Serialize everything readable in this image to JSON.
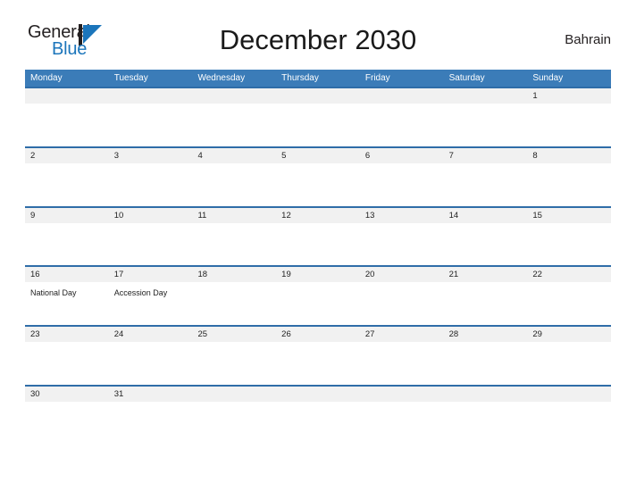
{
  "brand": {
    "word_one": "General",
    "word_two": "Blue",
    "mark_icon": "sailboat-flag-icon",
    "dark_color": "#231f20",
    "blue_color": "#1b75bb"
  },
  "header": {
    "title": "December 2030",
    "country": "Bahrain"
  },
  "colors": {
    "header_blue": "#3b7cb8",
    "row_divider_blue": "#2f6da8",
    "daynum_band_gray": "#f1f1f1",
    "page_background": "#ffffff",
    "text": "#222222"
  },
  "calendar": {
    "weekday_headers": [
      "Monday",
      "Tuesday",
      "Wednesday",
      "Thursday",
      "Friday",
      "Saturday",
      "Sunday"
    ],
    "weeks": [
      {
        "days": [
          {
            "number": "",
            "event": ""
          },
          {
            "number": "",
            "event": ""
          },
          {
            "number": "",
            "event": ""
          },
          {
            "number": "",
            "event": ""
          },
          {
            "number": "",
            "event": ""
          },
          {
            "number": "",
            "event": ""
          },
          {
            "number": "1",
            "event": ""
          }
        ]
      },
      {
        "days": [
          {
            "number": "2",
            "event": ""
          },
          {
            "number": "3",
            "event": ""
          },
          {
            "number": "4",
            "event": ""
          },
          {
            "number": "5",
            "event": ""
          },
          {
            "number": "6",
            "event": ""
          },
          {
            "number": "7",
            "event": ""
          },
          {
            "number": "8",
            "event": ""
          }
        ]
      },
      {
        "days": [
          {
            "number": "9",
            "event": ""
          },
          {
            "number": "10",
            "event": ""
          },
          {
            "number": "11",
            "event": ""
          },
          {
            "number": "12",
            "event": ""
          },
          {
            "number": "13",
            "event": ""
          },
          {
            "number": "14",
            "event": ""
          },
          {
            "number": "15",
            "event": ""
          }
        ]
      },
      {
        "days": [
          {
            "number": "16",
            "event": "National Day"
          },
          {
            "number": "17",
            "event": "Accession Day"
          },
          {
            "number": "18",
            "event": ""
          },
          {
            "number": "19",
            "event": ""
          },
          {
            "number": "20",
            "event": ""
          },
          {
            "number": "21",
            "event": ""
          },
          {
            "number": "22",
            "event": ""
          }
        ]
      },
      {
        "days": [
          {
            "number": "23",
            "event": ""
          },
          {
            "number": "24",
            "event": ""
          },
          {
            "number": "25",
            "event": ""
          },
          {
            "number": "26",
            "event": ""
          },
          {
            "number": "27",
            "event": ""
          },
          {
            "number": "28",
            "event": ""
          },
          {
            "number": "29",
            "event": ""
          }
        ]
      },
      {
        "days": [
          {
            "number": "30",
            "event": ""
          },
          {
            "number": "31",
            "event": ""
          },
          {
            "number": "",
            "event": ""
          },
          {
            "number": "",
            "event": ""
          },
          {
            "number": "",
            "event": ""
          },
          {
            "number": "",
            "event": ""
          },
          {
            "number": "",
            "event": ""
          }
        ]
      }
    ]
  }
}
